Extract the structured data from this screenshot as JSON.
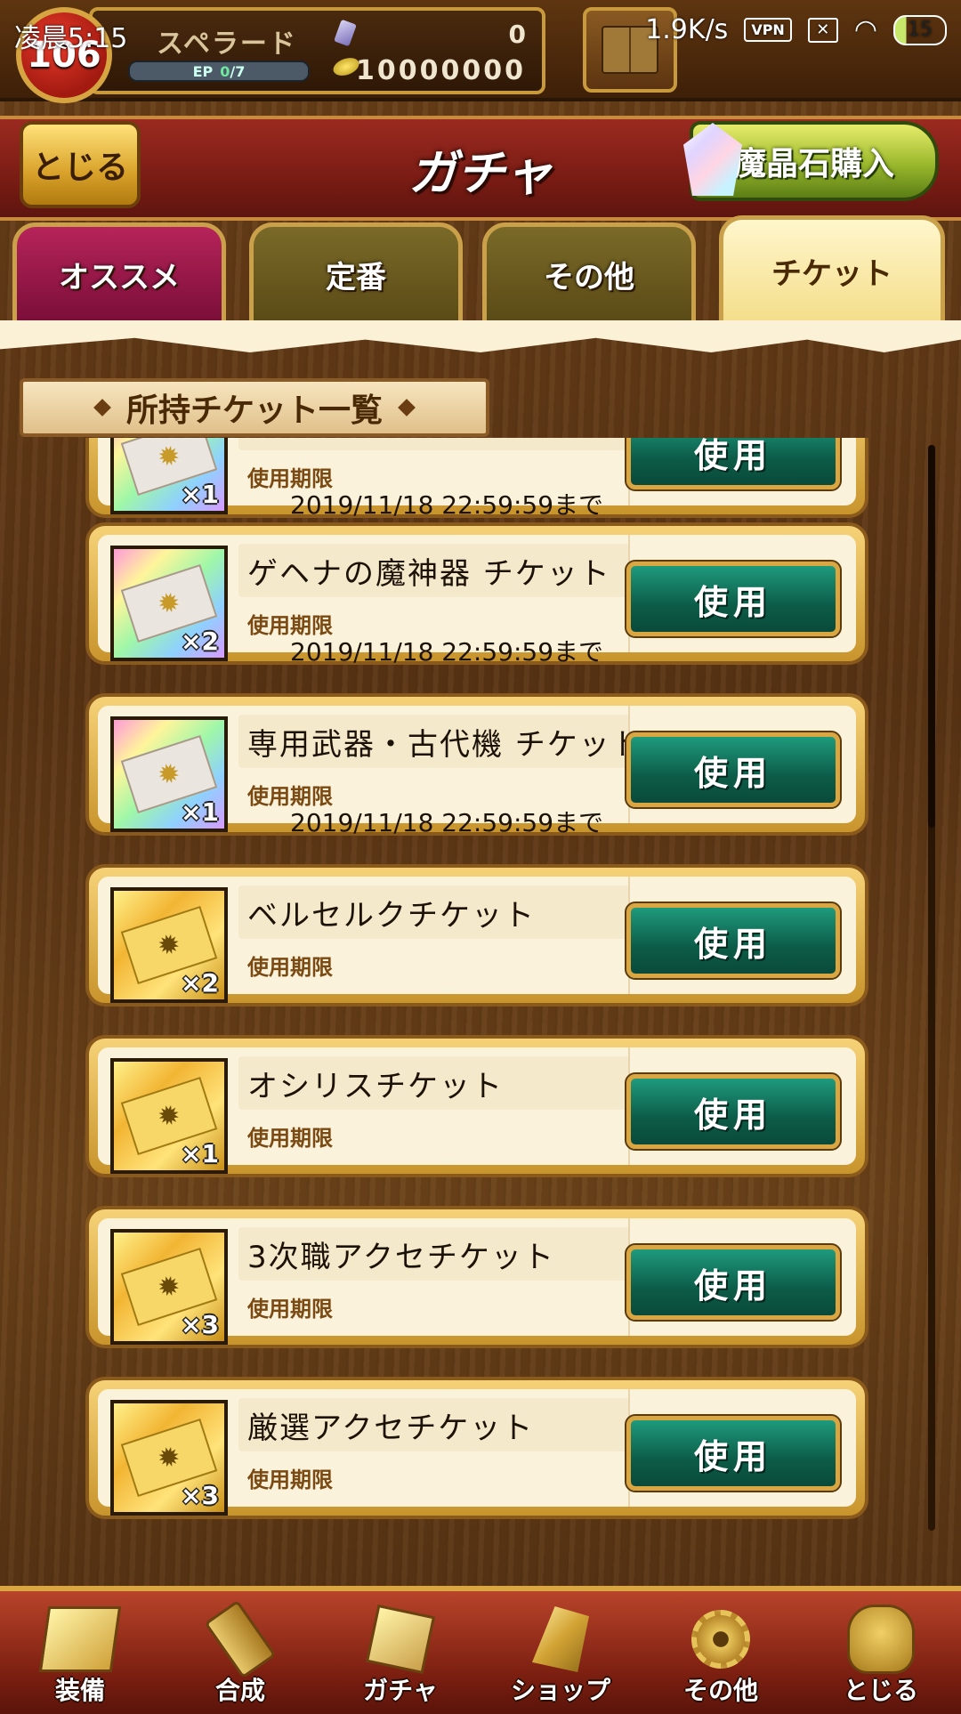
{
  "status_bar": {
    "time": "凌晨5:15",
    "net_speed": "1.9K/s",
    "vpn": "VPN",
    "battery": "15"
  },
  "player": {
    "level": "106",
    "name": "スペラード",
    "ep_label": "EP",
    "ep_current": "0",
    "ep_max": "/7",
    "crystal_count": "0",
    "gold_count": "10000000"
  },
  "header": {
    "close_label": "とじる",
    "title": "ガチャ",
    "buy_label": "魔晶石購入"
  },
  "tabs": [
    {
      "label": "オススメ"
    },
    {
      "label": "定番"
    },
    {
      "label": "その他"
    },
    {
      "label": "チケット"
    }
  ],
  "section_title": "所持チケット一覧",
  "tickets": [
    {
      "name": "",
      "expiry_label": "使用期限",
      "expiry": "2019/11/18 22:59:59まで",
      "count": "×1",
      "style": "rainbow",
      "use_label": "使用"
    },
    {
      "name": "ゲヘナの魔神器 チケット",
      "expiry_label": "使用期限",
      "expiry": "2019/11/18 22:59:59まで",
      "count": "×2",
      "style": "rainbow",
      "use_label": "使用"
    },
    {
      "name": "専用武器・古代機 チケット",
      "expiry_label": "使用期限",
      "expiry": "2019/11/18 22:59:59まで",
      "count": "×1",
      "style": "rainbow",
      "use_label": "使用"
    },
    {
      "name": "ベルセルクチケット",
      "expiry_label": "使用期限",
      "expiry": "",
      "count": "×2",
      "style": "gold",
      "use_label": "使用"
    },
    {
      "name": "オシリスチケット",
      "expiry_label": "使用期限",
      "expiry": "",
      "count": "×1",
      "style": "gold",
      "use_label": "使用"
    },
    {
      "name": "3次職アクセチケット",
      "expiry_label": "使用期限",
      "expiry": "",
      "count": "×3",
      "style": "gold",
      "use_label": "使用"
    },
    {
      "name": "厳選アクセチケット",
      "expiry_label": "使用期限",
      "expiry": "",
      "count": "×3",
      "style": "gold",
      "use_label": "使用"
    }
  ],
  "bottom_nav": [
    {
      "label": "装備",
      "icon": "equipment-icon"
    },
    {
      "label": "合成",
      "icon": "hammer-icon"
    },
    {
      "label": "ガチャ",
      "icon": "gacha-icon"
    },
    {
      "label": "ショップ",
      "icon": "crystal-shop-icon"
    },
    {
      "label": "その他",
      "icon": "gear-icon"
    },
    {
      "label": "とじる",
      "icon": "close-statue-icon"
    }
  ]
}
